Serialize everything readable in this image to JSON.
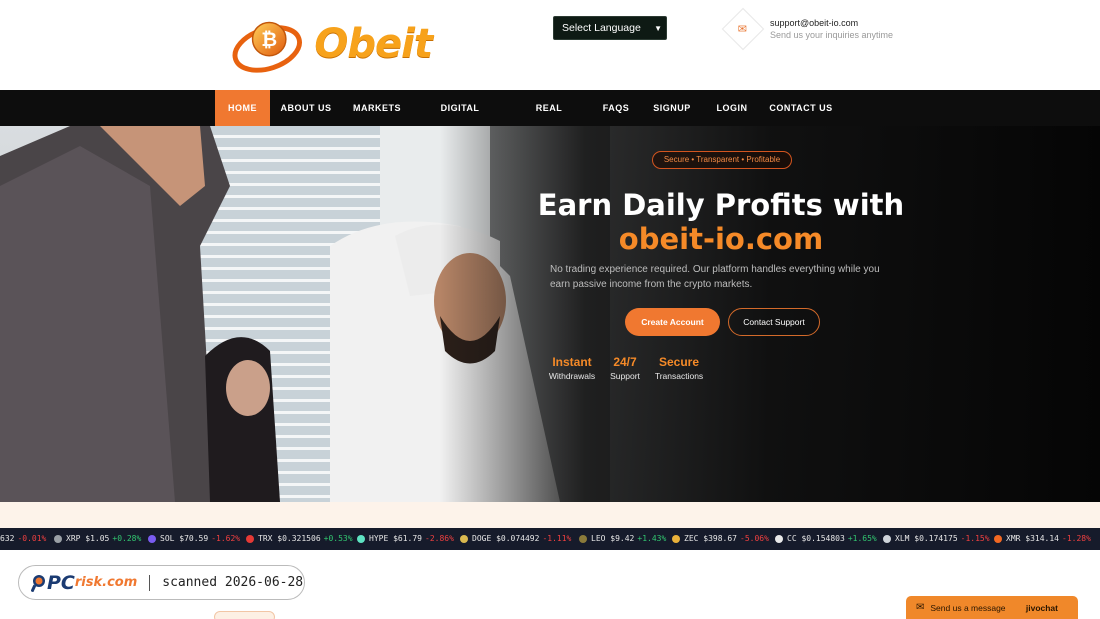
{
  "header": {
    "logo_text": "Obeit",
    "language_select": {
      "selected": "Select Language"
    },
    "contact": {
      "email": "support@obeit-io.com",
      "subtitle": "Send us your inquiries anytime"
    }
  },
  "nav": {
    "items": [
      {
        "label": "HOME",
        "active": true
      },
      {
        "label": "ABOUT US"
      },
      {
        "label": "MARKETS"
      },
      {
        "label": "DIGITAL ASSETS"
      },
      {
        "label": "REAL ESTATE"
      },
      {
        "label": "FAQS"
      },
      {
        "label": "SIGNUP"
      },
      {
        "label": "LOGIN"
      },
      {
        "label": "CONTACT US"
      }
    ]
  },
  "hero": {
    "badge": "Secure • Transparent • Profitable",
    "title_line1": "Earn Daily Profits with",
    "title_line2": "obeit-io.com",
    "description": "No trading experience required. Our platform handles everything while you earn passive income from the crypto markets.",
    "primary_button": "Create Account",
    "secondary_button": "Contact Support",
    "stats": [
      {
        "value": "Instant",
        "label": "Withdrawals"
      },
      {
        "value": "24/7",
        "label": "Support"
      },
      {
        "value": "Secure",
        "label": "Transactions"
      }
    ]
  },
  "ticker": [
    {
      "symbol": "",
      "price": "632",
      "change": "-0.01%",
      "dir": "down"
    },
    {
      "symbol": "XRP",
      "price": "$1.05",
      "change": "+0.28%",
      "dir": "up"
    },
    {
      "symbol": "SOL",
      "price": "$70.59",
      "change": "-1.62%",
      "dir": "down"
    },
    {
      "symbol": "TRX",
      "price": "$0.321506",
      "change": "+0.53%",
      "dir": "up"
    },
    {
      "symbol": "HYPE",
      "price": "$61.79",
      "change": "-2.86%",
      "dir": "down"
    },
    {
      "symbol": "DOGE",
      "price": "$0.074492",
      "change": "-1.11%",
      "dir": "down"
    },
    {
      "symbol": "LEO",
      "price": "$9.42",
      "change": "+1.43%",
      "dir": "up"
    },
    {
      "symbol": "ZEC",
      "price": "$398.67",
      "change": "-5.06%",
      "dir": "down"
    },
    {
      "symbol": "CC",
      "price": "$0.154803",
      "change": "+1.65%",
      "dir": "up"
    },
    {
      "symbol": "XLM",
      "price": "$0.174175",
      "change": "-1.15%",
      "dir": "down"
    },
    {
      "symbol": "XMR",
      "price": "$314.14",
      "change": "-1.28%",
      "dir": "down"
    }
  ],
  "watermark": {
    "brand_pc": "PC",
    "brand_risk": "risk.com",
    "scan_text": "scanned 2026-06-28"
  },
  "chat_widget": {
    "message": "Send us a message",
    "brand": "jivochat"
  },
  "colors": {
    "accent": "#f07830",
    "nav_bg": "#0d0d0d",
    "ticker_bg": "#161b2b",
    "up": "#32c670",
    "down": "#f04040"
  },
  "icons": {
    "contact": "mail-icon",
    "select": "chevron-down-icon",
    "chat": "mail-icon"
  }
}
